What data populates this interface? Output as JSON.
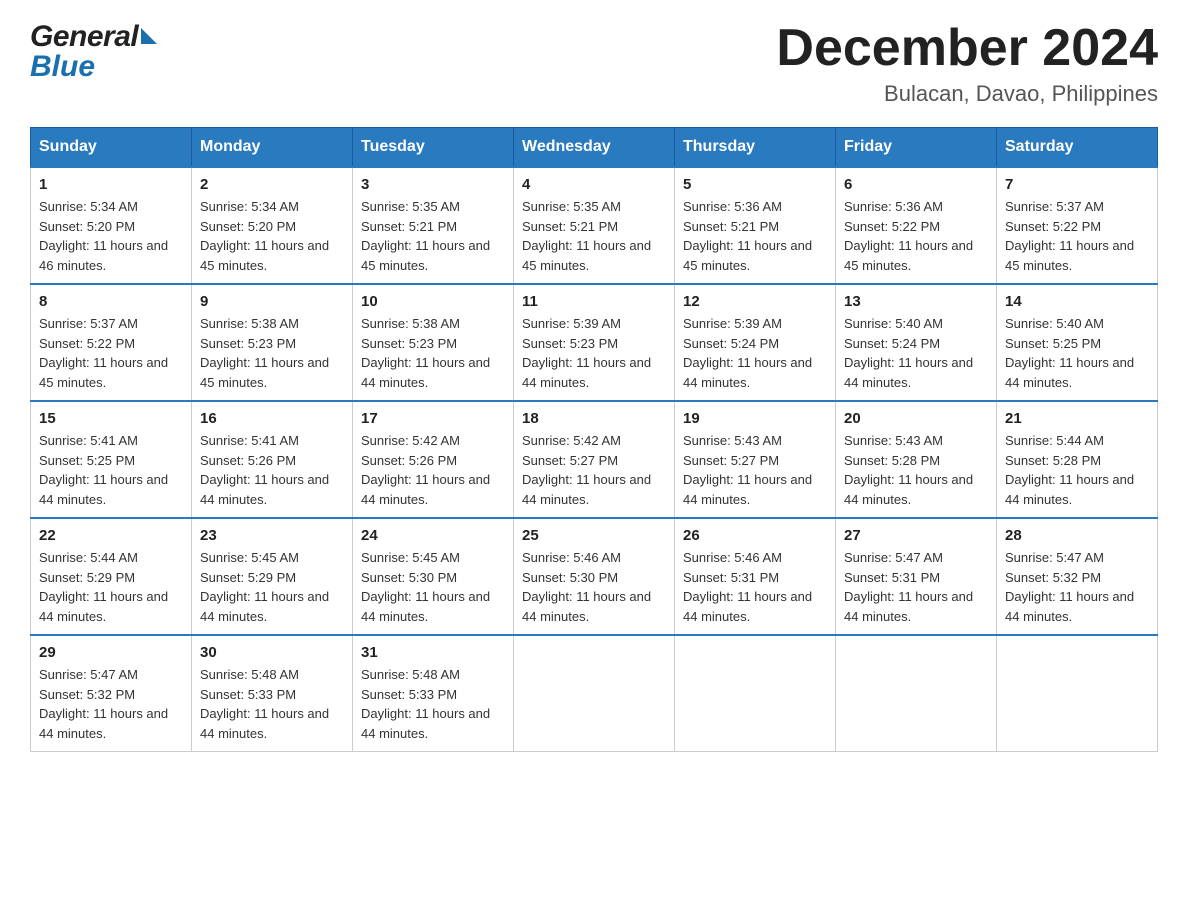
{
  "logo": {
    "general": "General",
    "blue": "Blue"
  },
  "title": "December 2024",
  "subtitle": "Bulacan, Davao, Philippines",
  "days_of_week": [
    "Sunday",
    "Monday",
    "Tuesday",
    "Wednesday",
    "Thursday",
    "Friday",
    "Saturday"
  ],
  "weeks": [
    [
      {
        "day": "1",
        "sunrise": "5:34 AM",
        "sunset": "5:20 PM",
        "daylight": "11 hours and 46 minutes."
      },
      {
        "day": "2",
        "sunrise": "5:34 AM",
        "sunset": "5:20 PM",
        "daylight": "11 hours and 45 minutes."
      },
      {
        "day": "3",
        "sunrise": "5:35 AM",
        "sunset": "5:21 PM",
        "daylight": "11 hours and 45 minutes."
      },
      {
        "day": "4",
        "sunrise": "5:35 AM",
        "sunset": "5:21 PM",
        "daylight": "11 hours and 45 minutes."
      },
      {
        "day": "5",
        "sunrise": "5:36 AM",
        "sunset": "5:21 PM",
        "daylight": "11 hours and 45 minutes."
      },
      {
        "day": "6",
        "sunrise": "5:36 AM",
        "sunset": "5:22 PM",
        "daylight": "11 hours and 45 minutes."
      },
      {
        "day": "7",
        "sunrise": "5:37 AM",
        "sunset": "5:22 PM",
        "daylight": "11 hours and 45 minutes."
      }
    ],
    [
      {
        "day": "8",
        "sunrise": "5:37 AM",
        "sunset": "5:22 PM",
        "daylight": "11 hours and 45 minutes."
      },
      {
        "day": "9",
        "sunrise": "5:38 AM",
        "sunset": "5:23 PM",
        "daylight": "11 hours and 45 minutes."
      },
      {
        "day": "10",
        "sunrise": "5:38 AM",
        "sunset": "5:23 PM",
        "daylight": "11 hours and 44 minutes."
      },
      {
        "day": "11",
        "sunrise": "5:39 AM",
        "sunset": "5:23 PM",
        "daylight": "11 hours and 44 minutes."
      },
      {
        "day": "12",
        "sunrise": "5:39 AM",
        "sunset": "5:24 PM",
        "daylight": "11 hours and 44 minutes."
      },
      {
        "day": "13",
        "sunrise": "5:40 AM",
        "sunset": "5:24 PM",
        "daylight": "11 hours and 44 minutes."
      },
      {
        "day": "14",
        "sunrise": "5:40 AM",
        "sunset": "5:25 PM",
        "daylight": "11 hours and 44 minutes."
      }
    ],
    [
      {
        "day": "15",
        "sunrise": "5:41 AM",
        "sunset": "5:25 PM",
        "daylight": "11 hours and 44 minutes."
      },
      {
        "day": "16",
        "sunrise": "5:41 AM",
        "sunset": "5:26 PM",
        "daylight": "11 hours and 44 minutes."
      },
      {
        "day": "17",
        "sunrise": "5:42 AM",
        "sunset": "5:26 PM",
        "daylight": "11 hours and 44 minutes."
      },
      {
        "day": "18",
        "sunrise": "5:42 AM",
        "sunset": "5:27 PM",
        "daylight": "11 hours and 44 minutes."
      },
      {
        "day": "19",
        "sunrise": "5:43 AM",
        "sunset": "5:27 PM",
        "daylight": "11 hours and 44 minutes."
      },
      {
        "day": "20",
        "sunrise": "5:43 AM",
        "sunset": "5:28 PM",
        "daylight": "11 hours and 44 minutes."
      },
      {
        "day": "21",
        "sunrise": "5:44 AM",
        "sunset": "5:28 PM",
        "daylight": "11 hours and 44 minutes."
      }
    ],
    [
      {
        "day": "22",
        "sunrise": "5:44 AM",
        "sunset": "5:29 PM",
        "daylight": "11 hours and 44 minutes."
      },
      {
        "day": "23",
        "sunrise": "5:45 AM",
        "sunset": "5:29 PM",
        "daylight": "11 hours and 44 minutes."
      },
      {
        "day": "24",
        "sunrise": "5:45 AM",
        "sunset": "5:30 PM",
        "daylight": "11 hours and 44 minutes."
      },
      {
        "day": "25",
        "sunrise": "5:46 AM",
        "sunset": "5:30 PM",
        "daylight": "11 hours and 44 minutes."
      },
      {
        "day": "26",
        "sunrise": "5:46 AM",
        "sunset": "5:31 PM",
        "daylight": "11 hours and 44 minutes."
      },
      {
        "day": "27",
        "sunrise": "5:47 AM",
        "sunset": "5:31 PM",
        "daylight": "11 hours and 44 minutes."
      },
      {
        "day": "28",
        "sunrise": "5:47 AM",
        "sunset": "5:32 PM",
        "daylight": "11 hours and 44 minutes."
      }
    ],
    [
      {
        "day": "29",
        "sunrise": "5:47 AM",
        "sunset": "5:32 PM",
        "daylight": "11 hours and 44 minutes."
      },
      {
        "day": "30",
        "sunrise": "5:48 AM",
        "sunset": "5:33 PM",
        "daylight": "11 hours and 44 minutes."
      },
      {
        "day": "31",
        "sunrise": "5:48 AM",
        "sunset": "5:33 PM",
        "daylight": "11 hours and 44 minutes."
      },
      null,
      null,
      null,
      null
    ]
  ]
}
